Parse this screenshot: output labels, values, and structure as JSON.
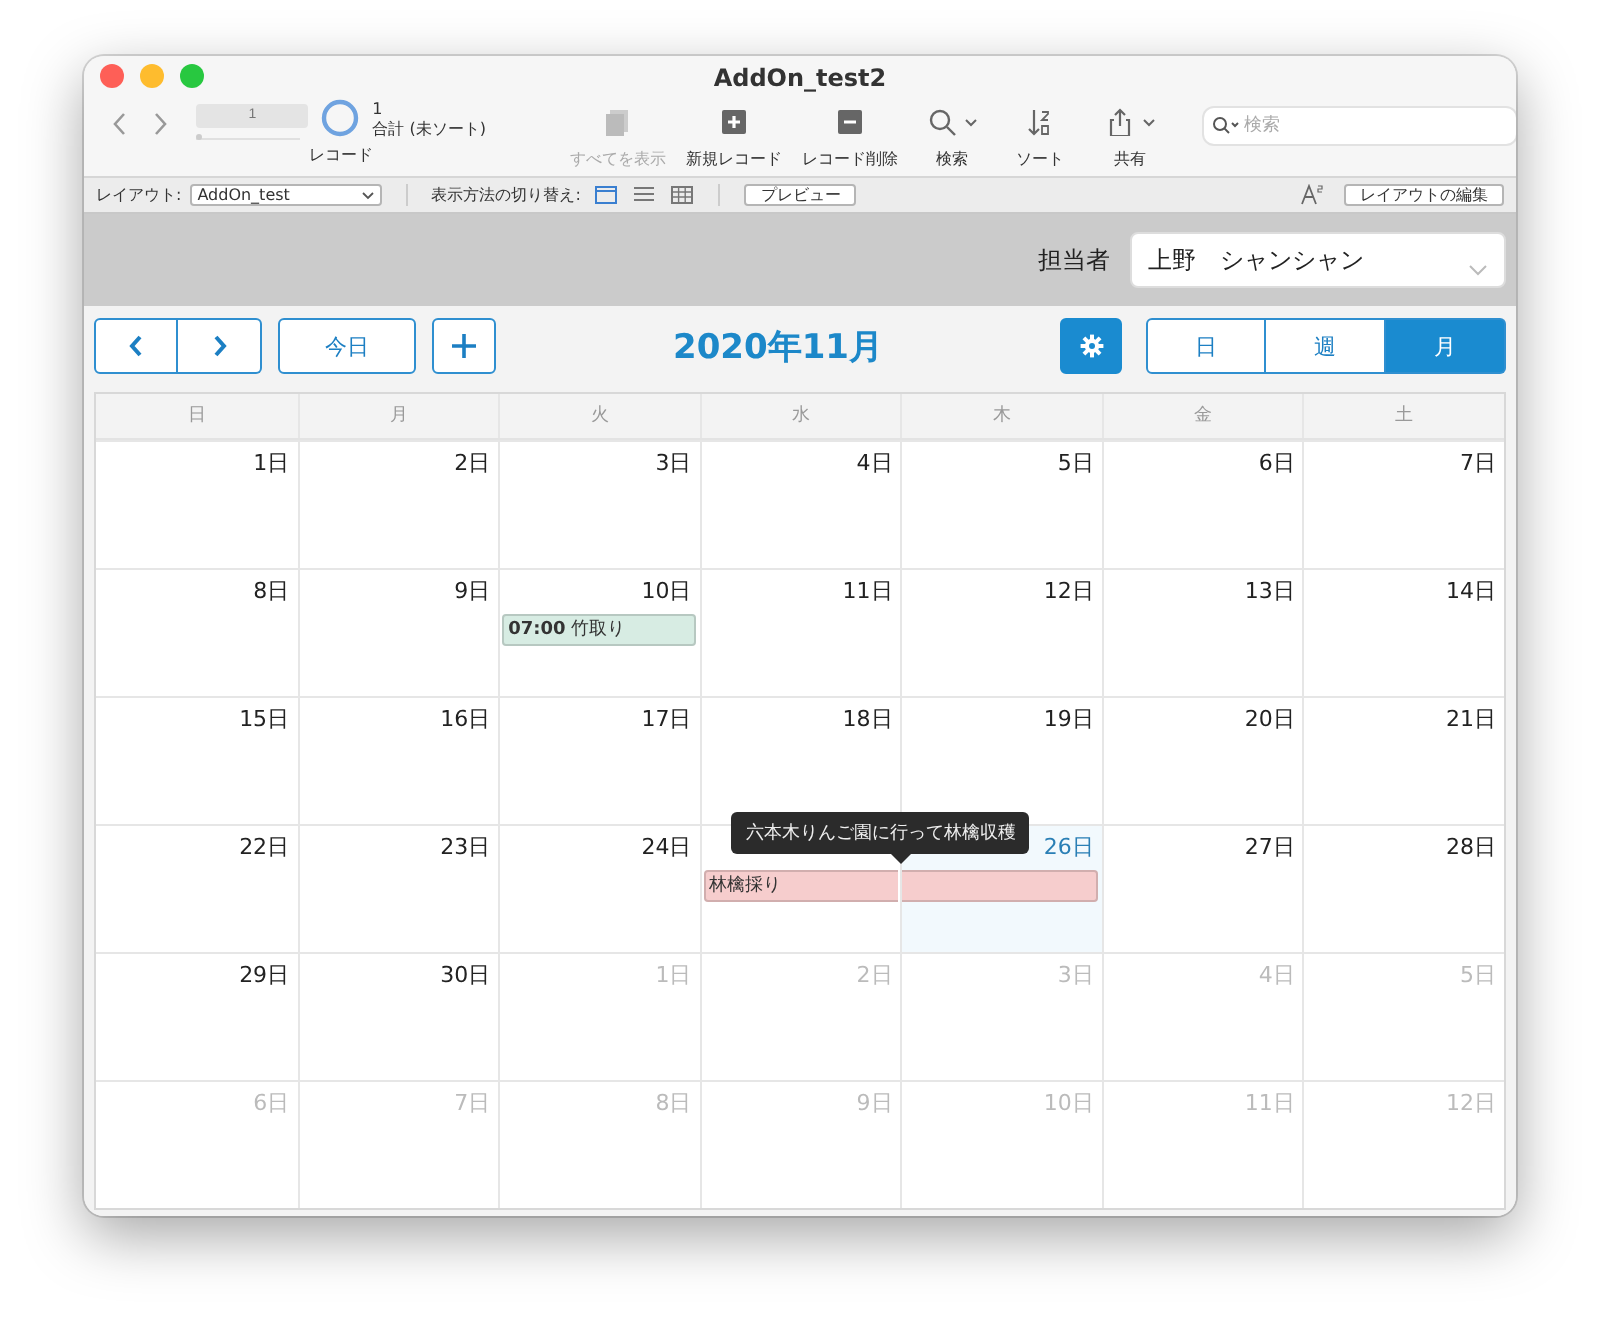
{
  "window": {
    "title": "AddOn_test2"
  },
  "toolbar": {
    "record_field": {
      "value": "1"
    },
    "record_slider": {
      "level": 0
    },
    "record_count": "1",
    "sort_status": "合計 (未ソート)",
    "record_label": "レコード",
    "tools": [
      {
        "kind": "show-all",
        "label": "すべてを表示",
        "disabled": true
      },
      {
        "kind": "new",
        "label": "新規レコード",
        "disabled": false
      },
      {
        "kind": "delete",
        "label": "レコード削除",
        "disabled": false
      },
      {
        "kind": "find",
        "label": "検索",
        "disabled": false
      },
      {
        "kind": "sort",
        "label": "ソート",
        "disabled": false
      },
      {
        "kind": "share",
        "label": "共有",
        "disabled": false
      }
    ],
    "search": {
      "placeholder": "検索"
    }
  },
  "layout_bar": {
    "layout_label": "レイアウト:",
    "layout_select": "AddOn_test",
    "view_label": "表示方法の切り替え:",
    "views": [
      {
        "kind": "form",
        "selected": true
      },
      {
        "kind": "list",
        "selected": false
      },
      {
        "kind": "table",
        "selected": false
      }
    ],
    "preview_button": "プレビュー",
    "edit_layout_button": "レイアウトの編集"
  },
  "header": {
    "label": "担当者",
    "value": "上野　シャンシャン"
  },
  "calendar": {
    "today_button": "今日",
    "title": "2020年11月",
    "views": [
      {
        "label": "日",
        "selected": false
      },
      {
        "label": "週",
        "selected": false
      },
      {
        "label": "月",
        "selected": true
      }
    ],
    "weekdays": [
      "日",
      "月",
      "火",
      "水",
      "木",
      "金",
      "土"
    ],
    "weeks": [
      {
        "days": [
          {
            "label": "1日",
            "muted": false,
            "today": false
          },
          {
            "label": "2日",
            "muted": false,
            "today": false
          },
          {
            "label": "3日",
            "muted": false,
            "today": false
          },
          {
            "label": "4日",
            "muted": false,
            "today": false
          },
          {
            "label": "5日",
            "muted": false,
            "today": false
          },
          {
            "label": "6日",
            "muted": false,
            "today": false
          },
          {
            "label": "7日",
            "muted": false,
            "today": false
          }
        ]
      },
      {
        "days": [
          {
            "label": "8日",
            "muted": false,
            "today": false
          },
          {
            "label": "9日",
            "muted": false,
            "today": false
          },
          {
            "label": "10日",
            "muted": false,
            "today": false,
            "events": [
              {
                "time": "07:00",
                "title": "竹取り",
                "color": "#d7ece3"
              }
            ]
          },
          {
            "label": "11日",
            "muted": false,
            "today": false
          },
          {
            "label": "12日",
            "muted": false,
            "today": false
          },
          {
            "label": "13日",
            "muted": false,
            "today": false
          },
          {
            "label": "14日",
            "muted": false,
            "today": false
          }
        ]
      },
      {
        "days": [
          {
            "label": "15日",
            "muted": false,
            "today": false
          },
          {
            "label": "16日",
            "muted": false,
            "today": false
          },
          {
            "label": "17日",
            "muted": false,
            "today": false
          },
          {
            "label": "18日",
            "muted": false,
            "today": false
          },
          {
            "label": "19日",
            "muted": false,
            "today": false
          },
          {
            "label": "20日",
            "muted": false,
            "today": false
          },
          {
            "label": "21日",
            "muted": false,
            "today": false
          }
        ]
      },
      {
        "days": [
          {
            "label": "22日",
            "muted": false,
            "today": false
          },
          {
            "label": "23日",
            "muted": false,
            "today": false
          },
          {
            "label": "24日",
            "muted": false,
            "today": false
          },
          {
            "today": false,
            "events": [
              {
                "title": "林檎採り",
                "color": "#f6cdcd",
                "tooltip": "六本木りんご園に行って林檎収穫"
              }
            ]
          },
          {
            "label": "26日",
            "muted": false,
            "today": true,
            "events": [
              {
                "continued": true,
                "color": "#f6cdcd"
              }
            ]
          },
          {
            "label": "27日",
            "muted": false,
            "today": false
          },
          {
            "label": "28日",
            "muted": false,
            "today": false
          }
        ]
      },
      {
        "days": [
          {
            "label": "29日",
            "muted": false,
            "today": false
          },
          {
            "label": "30日",
            "muted": false,
            "today": false
          },
          {
            "label": "1日",
            "muted": true,
            "today": false
          },
          {
            "label": "2日",
            "muted": true,
            "today": false
          },
          {
            "label": "3日",
            "muted": true,
            "today": false
          },
          {
            "label": "4日",
            "muted": true,
            "today": false
          },
          {
            "label": "5日",
            "muted": true,
            "today": false
          }
        ]
      },
      {
        "days": [
          {
            "label": "6日",
            "muted": true,
            "today": false
          },
          {
            "label": "7日",
            "muted": true,
            "today": false
          },
          {
            "label": "8日",
            "muted": true,
            "today": false
          },
          {
            "label": "9日",
            "muted": true,
            "today": false
          },
          {
            "label": "10日",
            "muted": true,
            "today": false
          },
          {
            "label": "11日",
            "muted": true,
            "today": false
          },
          {
            "label": "12日",
            "muted": true,
            "today": false
          }
        ]
      }
    ]
  }
}
